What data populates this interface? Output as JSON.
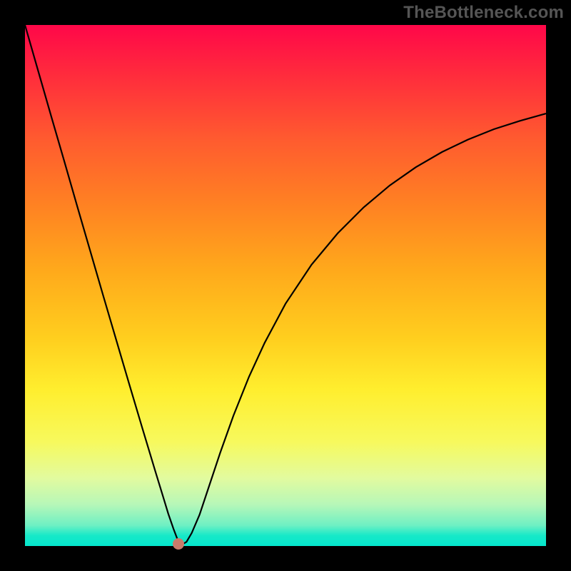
{
  "watermark": "TheBottleneck.com",
  "chart_data": {
    "type": "line",
    "title": "",
    "xlabel": "",
    "ylabel": "",
    "xlim": [
      0,
      100
    ],
    "ylim": [
      0,
      100
    ],
    "background": {
      "gradient_axis": "y",
      "stops": [
        {
          "pos": 0,
          "color": "#ff0749"
        },
        {
          "pos": 10,
          "color": "#ff2d3c"
        },
        {
          "pos": 22,
          "color": "#ff5b2f"
        },
        {
          "pos": 35,
          "color": "#ff8322"
        },
        {
          "pos": 47,
          "color": "#ffa91b"
        },
        {
          "pos": 60,
          "color": "#ffce1e"
        },
        {
          "pos": 70,
          "color": "#ffee2e"
        },
        {
          "pos": 80,
          "color": "#f7f95d"
        },
        {
          "pos": 87,
          "color": "#e2fb9f"
        },
        {
          "pos": 92,
          "color": "#b7f7b8"
        },
        {
          "pos": 96,
          "color": "#6ff0c3"
        },
        {
          "pos": 98,
          "color": "#17e9c8"
        },
        {
          "pos": 100,
          "color": "#05e6cd"
        }
      ]
    },
    "series": [
      {
        "name": "bottleneck-curve",
        "color": "#000000",
        "stroke_width": 2.2,
        "x": [
          0.0,
          2.5,
          5.0,
          7.5,
          10.0,
          12.5,
          15.0,
          17.5,
          20.0,
          22.5,
          25.0,
          26.5,
          27.5,
          28.5,
          29.3,
          30.0,
          31.0,
          32.0,
          33.5,
          35.0,
          37.5,
          40.0,
          43.0,
          46.0,
          50.0,
          55.0,
          60.0,
          65.0,
          70.0,
          75.0,
          80.0,
          85.0,
          90.0,
          95.0,
          100.0
        ],
        "y": [
          100.0,
          91.3,
          82.6,
          74.0,
          65.3,
          56.7,
          48.1,
          39.6,
          31.1,
          22.7,
          14.4,
          9.5,
          6.2,
          3.3,
          1.2,
          0.2,
          0.8,
          2.5,
          6.0,
          10.5,
          18.0,
          25.0,
          32.5,
          39.0,
          46.5,
          54.0,
          60.0,
          65.0,
          69.2,
          72.7,
          75.6,
          78.0,
          80.0,
          81.6,
          83.0
        ]
      }
    ],
    "marker": {
      "x": 29.5,
      "y": 0.4,
      "color": "#c97b6b",
      "radius": 8
    }
  }
}
